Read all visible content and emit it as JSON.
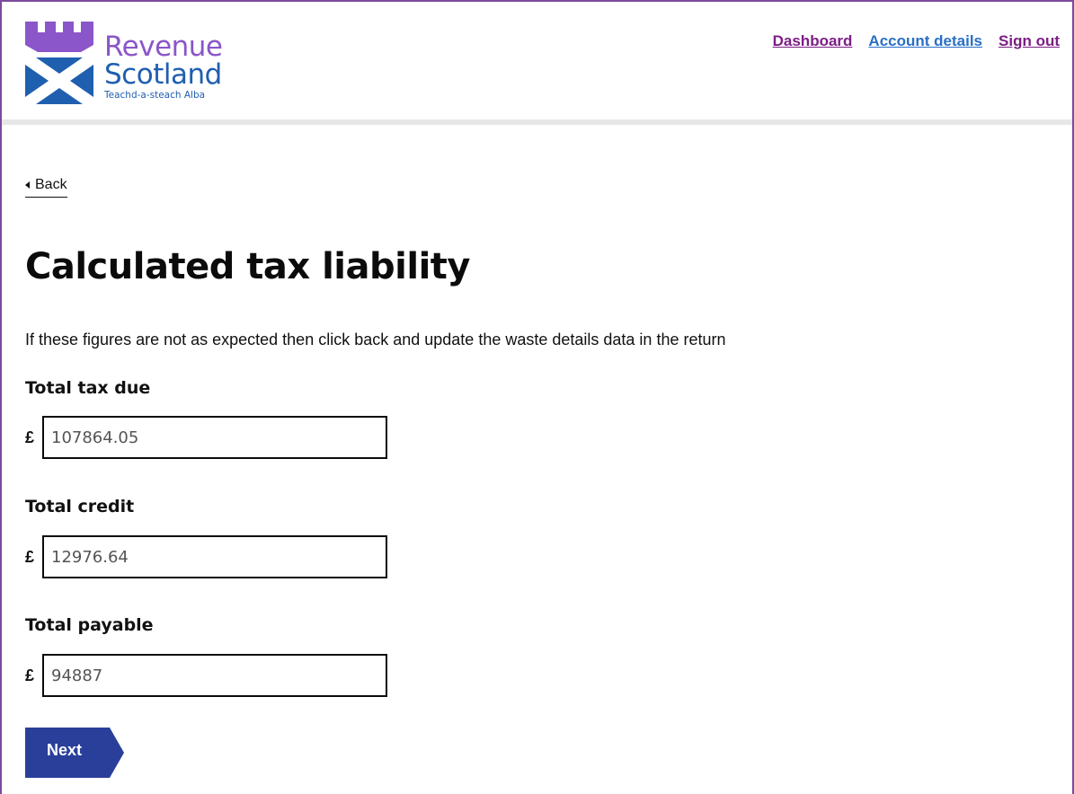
{
  "header": {
    "logo": {
      "line1": "Revenue",
      "line2": "Scotland",
      "line3": "Teachd-a-steach Alba"
    },
    "nav": [
      {
        "label": "Dashboard",
        "state": "visited"
      },
      {
        "label": "Account details",
        "state": "link"
      },
      {
        "label": "Sign out",
        "state": "visited"
      }
    ]
  },
  "main": {
    "back_label": "Back",
    "title": "Calculated tax liability",
    "intro": "If these figures are not as expected then click back and update the waste details data in the return",
    "fields": [
      {
        "label": "Total tax due",
        "currency": "£",
        "value": "107864.05"
      },
      {
        "label": "Total credit",
        "currency": "£",
        "value": "12976.64"
      },
      {
        "label": "Total payable",
        "currency": "£",
        "value": "94887"
      }
    ],
    "next_label": "Next"
  },
  "colors": {
    "brand_purple": "#8a56c9",
    "brand_blue": "#1f5fb0",
    "button_navy": "#2a3f9a",
    "visited_link": "#7b1f84",
    "link": "#2a6fc4"
  }
}
